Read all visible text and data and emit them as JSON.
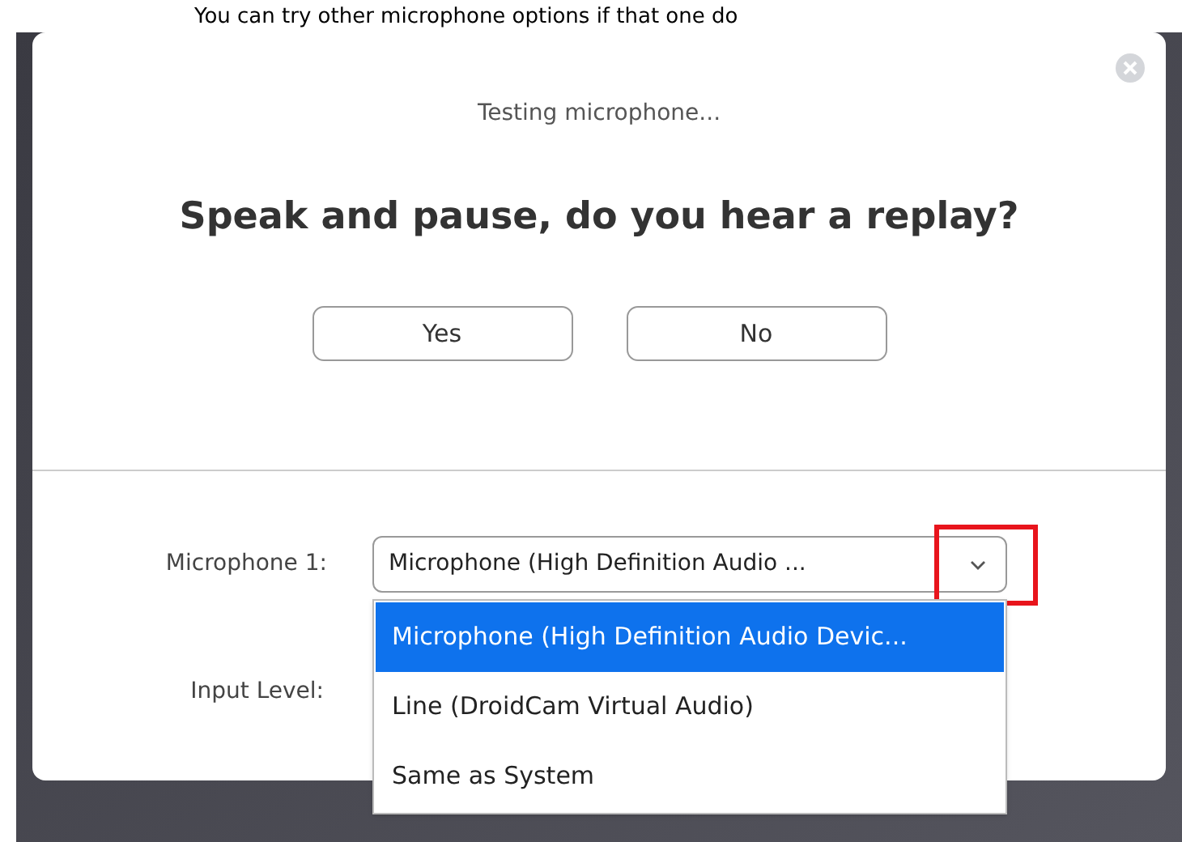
{
  "caption": "You can try other microphone options if that one do",
  "dialog": {
    "status": "Testing microphone...",
    "question": "Speak and pause, do you hear a replay?",
    "buttons": [
      "Yes",
      "No"
    ],
    "microphone": {
      "label": "Microphone 1:",
      "value": "Microphone (High Definition Audio ...",
      "expanded": true,
      "options": [
        {
          "label": "Microphone (High Definition Audio Devic...",
          "selected": true
        },
        {
          "label": "Line (DroidCam Virtual Audio)",
          "selected": false
        },
        {
          "label": "Same as System",
          "selected": false
        }
      ]
    },
    "input_level": {
      "label": "Input Level:"
    }
  }
}
